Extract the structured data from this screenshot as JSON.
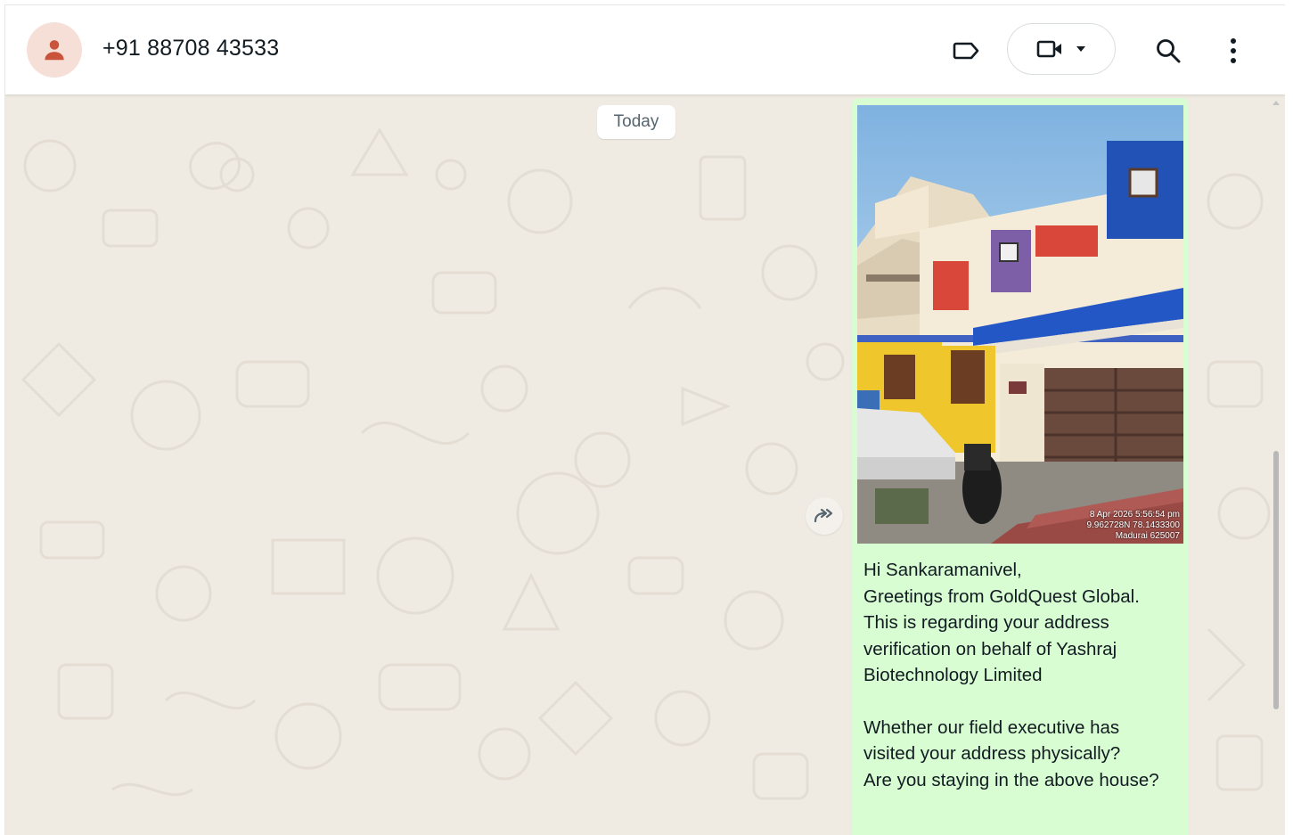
{
  "header": {
    "contact_name": "+91 88708 43533",
    "icons": {
      "avatar": "person-icon",
      "label": "label-icon",
      "video": "video-camera-icon",
      "dropdown": "caret-down-icon",
      "search": "search-icon",
      "menu": "vertical-dots-icon"
    }
  },
  "chat": {
    "date_chip": "Today",
    "message": {
      "image_overlay": [
        "8 Apr 2026 5:56:54 pm",
        "9.962728N 78.1433300",
        "Madurai 625007"
      ],
      "lines": [
        "Hi Sankaramanivel,",
        "Greetings from GoldQuest Global.",
        "This is regarding your address",
        "verification on behalf of Yashraj",
        "Biotechnology Limited",
        "",
        "Whether our field executive has",
        "visited your address physically?",
        "Are you staying in the above house?"
      ]
    },
    "forward_icon": "forward-arrow-icon"
  },
  "colors": {
    "bubble": "#d9fdd3",
    "wallpaper": "#efeae2",
    "avatar_bg": "#f6dfd6",
    "avatar_icon": "#c9533b"
  }
}
